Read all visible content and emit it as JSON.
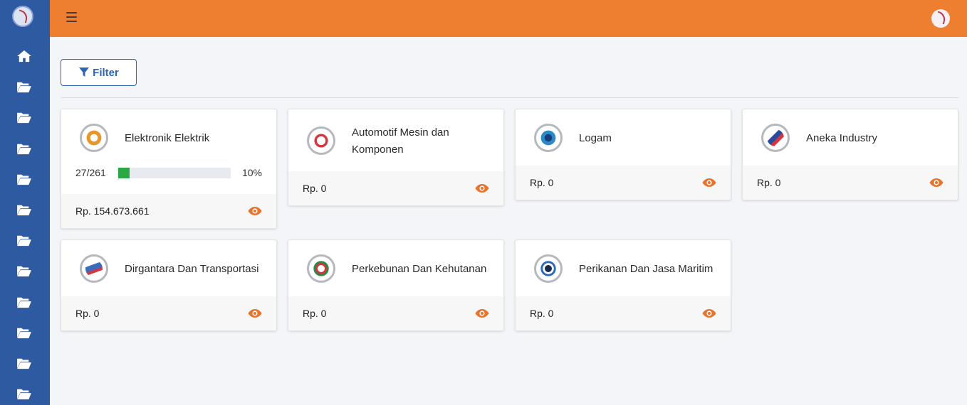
{
  "filter": {
    "label": "Filter"
  },
  "sidebar": {
    "items": [
      {
        "icon": "home-icon"
      },
      {
        "icon": "folder-open-icon"
      },
      {
        "icon": "folder-open-icon"
      },
      {
        "icon": "folder-open-icon"
      },
      {
        "icon": "folder-open-icon"
      },
      {
        "icon": "folder-open-icon"
      },
      {
        "icon": "folder-open-icon"
      },
      {
        "icon": "folder-open-icon"
      },
      {
        "icon": "folder-open-icon"
      },
      {
        "icon": "folder-open-icon"
      },
      {
        "icon": "folder-open-icon"
      },
      {
        "icon": "folder-open-icon"
      }
    ]
  },
  "colors": {
    "sidebar": "#2d5aa0",
    "topbar": "#ef7f30",
    "accent": "#e8732c",
    "progress": "#2aa844"
  },
  "cards": [
    {
      "title": "Elektronik Elektrik",
      "amount": "Rp. 154.673.661",
      "progress_count": "27/261",
      "progress_pct": "10%",
      "progress_value": 0.1
    },
    {
      "title": "Automotif Mesin dan Komponen",
      "amount": "Rp. 0"
    },
    {
      "title": "Logam",
      "amount": "Rp. 0"
    },
    {
      "title": "Aneka Industry",
      "amount": "Rp. 0"
    },
    {
      "title": "Dirgantara Dan Transportasi",
      "amount": "Rp. 0"
    },
    {
      "title": "Perkebunan Dan Kehutanan",
      "amount": "Rp. 0"
    },
    {
      "title": "Perikanan Dan Jasa Maritim",
      "amount": "Rp. 0"
    }
  ]
}
